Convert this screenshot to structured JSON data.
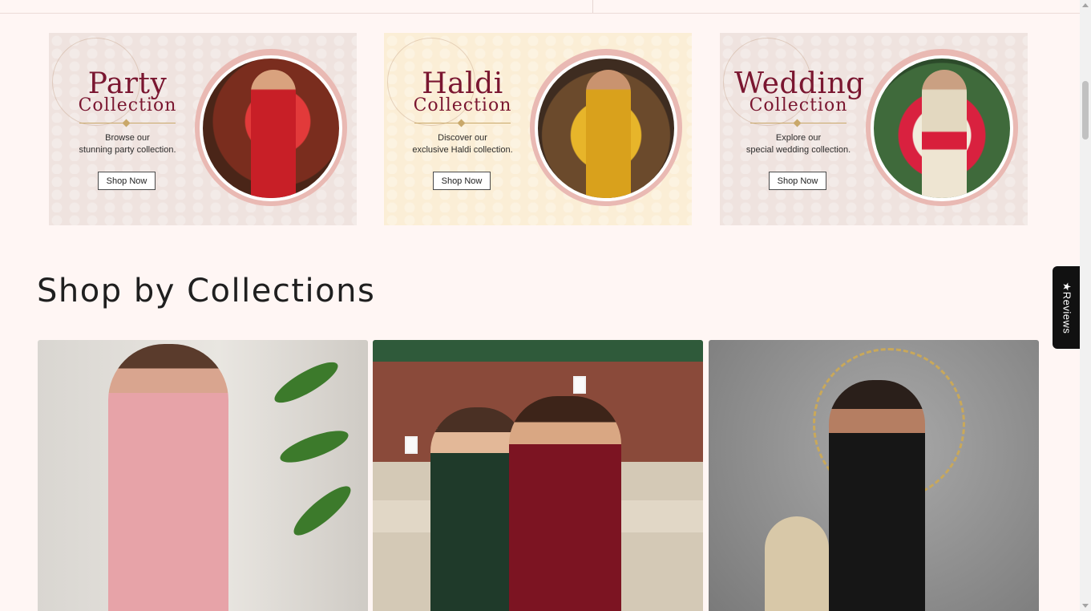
{
  "banners": [
    {
      "title_line1": "Party",
      "title_line2": "Collection",
      "subtitle_line1": "Browse our",
      "subtitle_line2": "stunning party collection.",
      "button": "Shop Now"
    },
    {
      "title_line1": "Haldi",
      "title_line2": "Collection",
      "subtitle_line1": "Discover our",
      "subtitle_line2": "exclusive Haldi collection.",
      "button": "Shop Now"
    },
    {
      "title_line1": "Wedding",
      "title_line2": "Collection",
      "subtitle_line1": "Explore our",
      "subtitle_line2": "special wedding collection.",
      "button": "Shop Now"
    }
  ],
  "section": {
    "title": "Shop by Collections"
  },
  "reviews_tab": {
    "label": "★Reviews"
  },
  "colors": {
    "background": "#fff6f4",
    "accent": "#7a1630",
    "reviews_tab": "#111111"
  }
}
